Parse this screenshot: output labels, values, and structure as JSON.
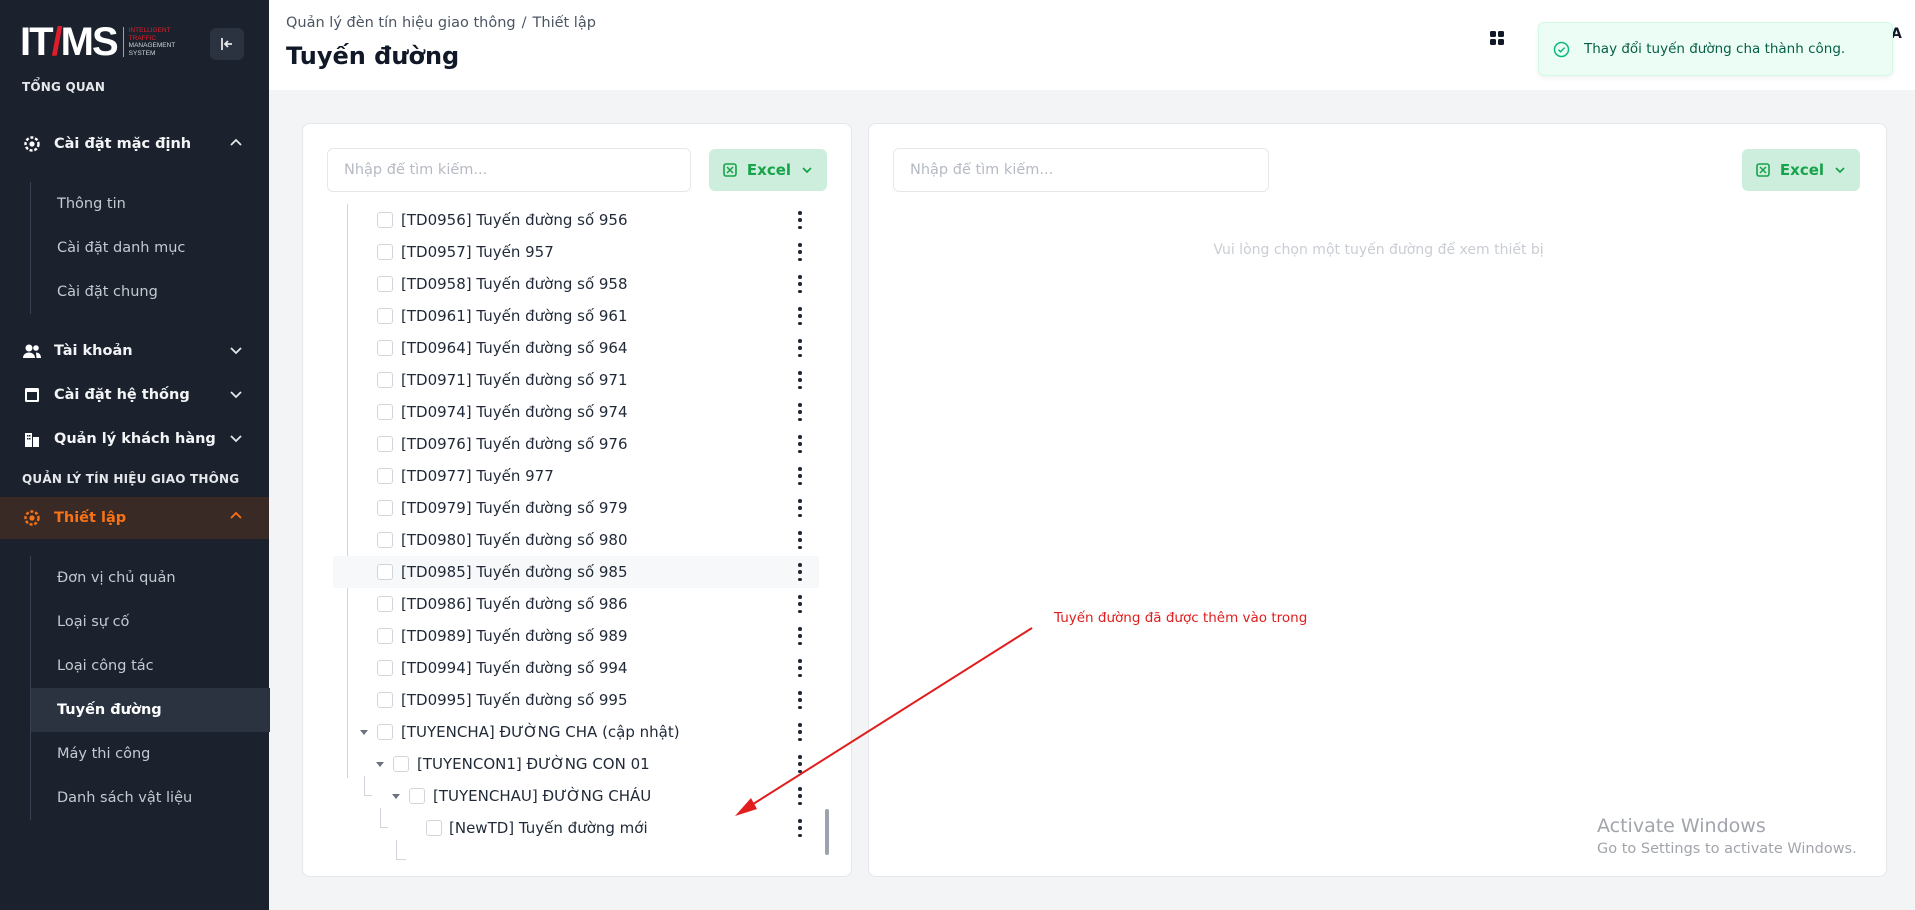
{
  "sidebar": {
    "logo": {
      "main_left": "IT",
      "main_right": "MS",
      "sub_line1": "INTELLIGENT",
      "sub_line2": "TRAFFIC",
      "sub_line3": "MANAGEMENT",
      "sub_line4": "SYSTEM"
    },
    "section_overview": "TỔNG QUAN",
    "menu_default_settings": "Cài đặt mặc định",
    "default_settings_items": [
      "Thông tin",
      "Cài đặt danh mục",
      "Cài đặt chung"
    ],
    "menu_account": "Tài khoản",
    "menu_system_settings": "Cài đặt hệ thống",
    "menu_customers": "Quản lý khách hàng",
    "section_traffic": "QUẢN LÝ TÍN HIỆU GIAO THÔNG",
    "menu_setup": "Thiết lập",
    "setup_items": [
      "Đơn vị chủ quản",
      "Loại sự cố",
      "Loại công tác",
      "Tuyến đường",
      "Máy thi công",
      "Danh sách vật liệu"
    ],
    "active_setup_item": "Tuyến đường",
    "accent_color": "#f97316"
  },
  "header": {
    "breadcrumb": [
      "Quản lý đèn tín hiệu giao thông",
      "Thiết lập"
    ],
    "breadcrumb_sep": "/",
    "title": "Tuyến đường",
    "right_letter": "A"
  },
  "toast": {
    "message": "Thay đổi tuyến đường cha thành công.",
    "type": "success",
    "color": "#10b981"
  },
  "left_panel": {
    "search_placeholder": "Nhập để tìm kiếm...",
    "excel_label": "Excel",
    "tree": [
      {
        "label": "[TD0956] Tuyến đường số 956",
        "level": 0
      },
      {
        "label": "[TD0957] Tuyến 957",
        "level": 0
      },
      {
        "label": "[TD0958] Tuyến đường số 958",
        "level": 0
      },
      {
        "label": "[TD0961] Tuyến đường số 961",
        "level": 0
      },
      {
        "label": "[TD0964] Tuyến đường số 964",
        "level": 0
      },
      {
        "label": "[TD0971] Tuyến đường số 971",
        "level": 0
      },
      {
        "label": "[TD0974] Tuyến đường số 974",
        "level": 0
      },
      {
        "label": "[TD0976] Tuyến đường số 976",
        "level": 0
      },
      {
        "label": "[TD0977] Tuyến 977",
        "level": 0
      },
      {
        "label": "[TD0979] Tuyến đường số 979",
        "level": 0
      },
      {
        "label": "[TD0980] Tuyến đường số 980",
        "level": 0
      },
      {
        "label": "[TD0985] Tuyến đường số 985",
        "level": 0
      },
      {
        "label": "[TD0986] Tuyến đường số 986",
        "level": 0
      },
      {
        "label": "[TD0989] Tuyến đường số 989",
        "level": 0
      },
      {
        "label": "[TD0994] Tuyến đường số 994",
        "level": 0
      },
      {
        "label": "[TD0995] Tuyến đường số 995",
        "level": 0
      },
      {
        "label": "[TUYENCHA] ĐƯỜNG CHA (cập nhật)",
        "level": 0,
        "expanded": true
      },
      {
        "label": "[TUYENCON1] ĐƯỜNG CON 01",
        "level": 1,
        "expanded": true
      },
      {
        "label": "[TUYENCHAU] ĐƯỜNG CHÁU",
        "level": 2,
        "expanded": true
      },
      {
        "label": "[NewTD] Tuyến đường mới",
        "level": 3
      }
    ]
  },
  "right_panel": {
    "search_placeholder": "Nhập để tìm kiếm...",
    "excel_label": "Excel",
    "empty_message": "Vui lòng chọn một tuyến đường để xem thiết bị"
  },
  "annotation": {
    "text": "Tuyến đường đã được thêm vào trong",
    "color": "#e11d1d"
  },
  "watermark": {
    "line1": "Activate Windows",
    "line2": "Go to Settings to activate Windows."
  }
}
